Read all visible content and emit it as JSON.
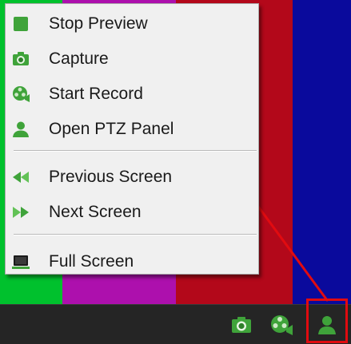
{
  "menu": {
    "items": [
      {
        "label": "Stop Preview",
        "icon": "stop-preview-icon"
      },
      {
        "label": "Capture",
        "icon": "camera-icon"
      },
      {
        "label": "Start Record",
        "icon": "video-camera-icon"
      },
      {
        "label": "Open PTZ Panel",
        "icon": "ptz-person-icon"
      },
      {
        "label": "Previous Screen",
        "icon": "previous-arrow-icon"
      },
      {
        "label": "Next Screen",
        "icon": "next-arrow-icon"
      },
      {
        "label": "Full Screen",
        "icon": "monitor-icon"
      }
    ]
  },
  "toolbar": {
    "buttons": [
      {
        "icon": "camera-icon"
      },
      {
        "icon": "video-camera-icon"
      },
      {
        "icon": "ptz-person-icon",
        "highlighted": true
      }
    ]
  },
  "colors": {
    "icon_green": "#3fa33a",
    "annotation_red": "#e10b10",
    "toolbar_bg": "#252525",
    "menu_bg": "#f0f0f0",
    "color_bars": [
      "#00c12d",
      "#ad10ad",
      "#b3081a",
      "#0a0a9c"
    ]
  }
}
